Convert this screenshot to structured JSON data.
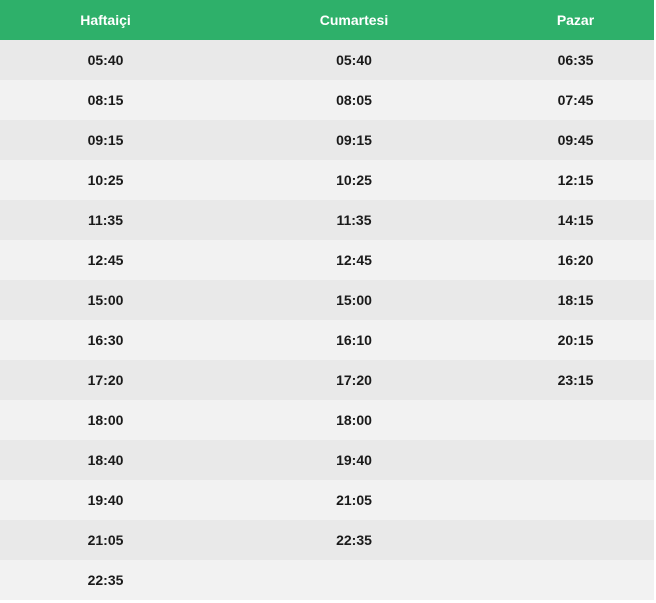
{
  "table": {
    "headers": [
      "Haftaiçi",
      "Cumartesi",
      "Pazar"
    ],
    "rows": [
      [
        "05:40",
        "05:40",
        "06:35"
      ],
      [
        "08:15",
        "08:05",
        "07:45"
      ],
      [
        "09:15",
        "09:15",
        "09:45"
      ],
      [
        "10:25",
        "10:25",
        "12:15"
      ],
      [
        "11:35",
        "11:35",
        "14:15"
      ],
      [
        "12:45",
        "12:45",
        "16:20"
      ],
      [
        "15:00",
        "15:00",
        "18:15"
      ],
      [
        "16:30",
        "16:10",
        "20:15"
      ],
      [
        "17:20",
        "17:20",
        "23:15"
      ],
      [
        "18:00",
        "18:00",
        ""
      ],
      [
        "18:40",
        "19:40",
        ""
      ],
      [
        "19:40",
        "21:05",
        ""
      ],
      [
        "21:05",
        "22:35",
        ""
      ],
      [
        "22:35",
        "",
        ""
      ]
    ]
  },
  "colors": {
    "header_bg": "#2eb06a",
    "header_text": "#ffffff",
    "row_odd": "#e9e9e9",
    "row_even": "#f2f2f2",
    "cell_text": "#1a1a1a"
  }
}
